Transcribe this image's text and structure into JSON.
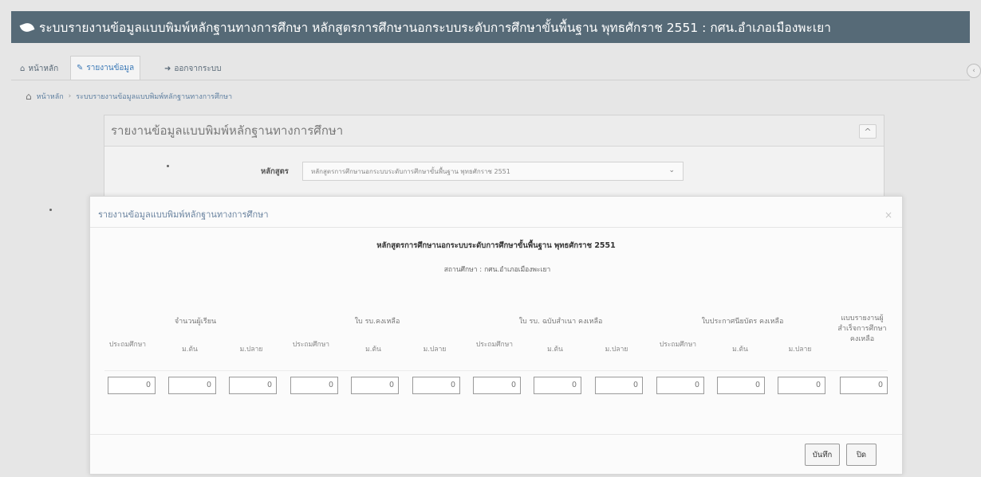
{
  "app": {
    "title": "ระบบรายงานข้อมูลแบบพิมพ์หลักฐานทางการศึกษา หลักสูตรการศึกษานอกระบบระดับการศึกษาขั้นพื้นฐาน พุทธศักราช 2551 : กศน.อำเภอเมืองพะเยา"
  },
  "nav": {
    "home": "หน้าหลัก",
    "report": "รายงานข้อมูล",
    "logout": "ออกจากระบบ"
  },
  "breadcrumb": {
    "home": "หน้าหลัก",
    "sep": "›",
    "current": "ระบบรายงานข้อมูลแบบพิมพ์หลักฐานทางการศึกษา"
  },
  "panel": {
    "title": "รายงานข้อมูลแบบพิมพ์หลักฐานทางการศึกษา",
    "collapse": "^",
    "curriculum_label": "หลักสูตร",
    "curriculum_value": "หลักสูตรการศึกษานอกระบบระดับการศึกษาขั้นพื้นฐาน พุทธศักราช 2551"
  },
  "modal": {
    "title": "รายงานข้อมูลแบบพิมพ์หลักฐานทางการศึกษา",
    "close": "×",
    "heading": "หลักสูตรการศึกษานอกระบบระดับการศึกษาขั้นพื้นฐาน พุทธศักราช 2551",
    "school_label": "สถานศึกษา :",
    "school_value": "กศน.อำเภอเมืองพะเยา",
    "groups": [
      "จำนวนผู้เรียน",
      "ใบ รบ.คงเหลือ",
      "ใบ รบ. ฉบับสำเนา คงเหลือ",
      "ใบประกาศนียบัตร คงเหลือ",
      "แบบรายงานผู้สำเร็จการศึกษา คงเหลือ"
    ],
    "subheads": [
      "ประถมศึกษา",
      "ม.ต้น",
      "ม.ปลาย",
      "ประถมศึกษา",
      "ม.ต้น",
      "ม.ปลาย",
      "ประถมศึกษา",
      "ม.ต้น",
      "ม.ปลาย",
      "ประถมศึกษา",
      "ม.ต้น",
      "ม.ปลาย"
    ],
    "values": [
      "0",
      "0",
      "0",
      "0",
      "0",
      "0",
      "0",
      "0",
      "0",
      "0",
      "0",
      "0",
      "0"
    ],
    "save_button": "บันทึก",
    "close_button": "ปิด"
  }
}
